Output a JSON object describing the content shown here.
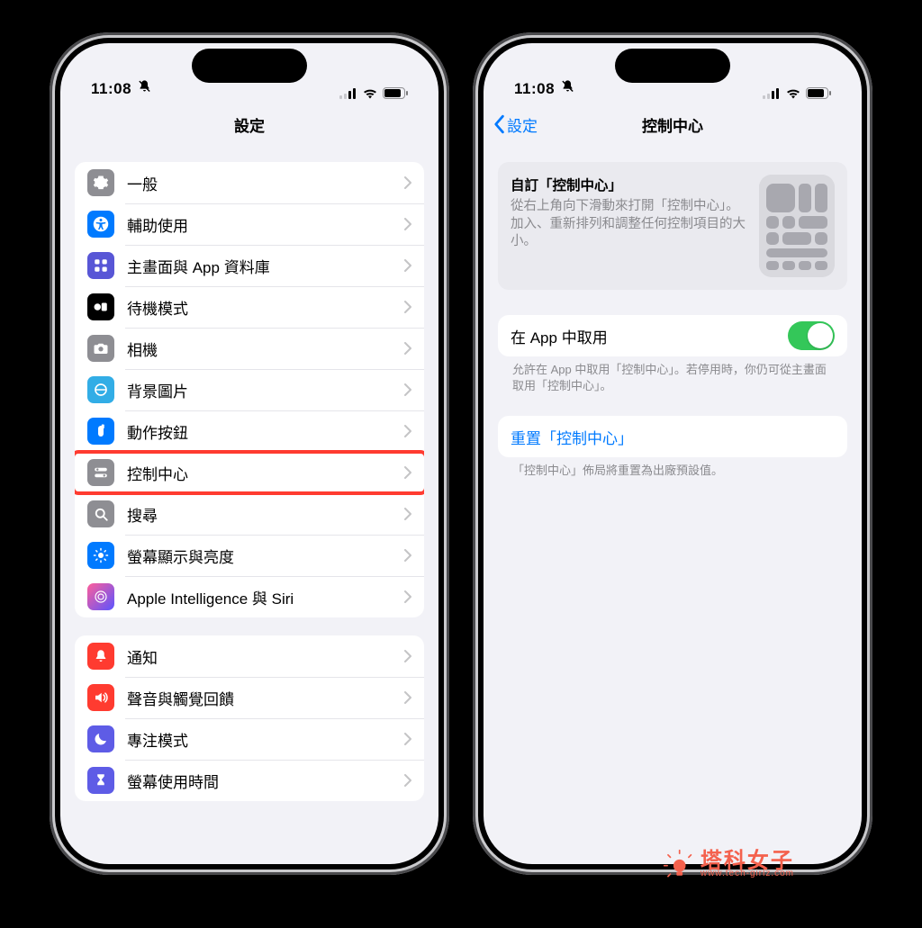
{
  "status": {
    "time": "11:08",
    "silent": true
  },
  "left": {
    "navTitle": "設定",
    "section1": [
      {
        "key": "general",
        "label": "一般",
        "iconBg": "bg-gray",
        "icon": "gear"
      },
      {
        "key": "accessibility",
        "label": "輔助使用",
        "iconBg": "bg-blue",
        "icon": "accessibility"
      },
      {
        "key": "homescreen",
        "label": "主畫面與 App 資料庫",
        "iconBg": "bg-purple",
        "icon": "homegrid"
      },
      {
        "key": "standby",
        "label": "待機模式",
        "iconBg": "bg-black",
        "icon": "standby"
      },
      {
        "key": "camera",
        "label": "相機",
        "iconBg": "bg-gray",
        "icon": "camera"
      },
      {
        "key": "wallpaper",
        "label": "背景圖片",
        "iconBg": "bg-cyan",
        "icon": "wallpaper"
      },
      {
        "key": "actionbutton",
        "label": "動作按鈕",
        "iconBg": "bg-blue",
        "icon": "action"
      },
      {
        "key": "controlcenter",
        "label": "控制中心",
        "iconBg": "bg-gray",
        "icon": "switches",
        "highlight": true
      },
      {
        "key": "search",
        "label": "搜尋",
        "iconBg": "bg-gray",
        "icon": "search"
      },
      {
        "key": "display",
        "label": "螢幕顯示與亮度",
        "iconBg": "bg-blue",
        "icon": "brightness"
      },
      {
        "key": "ai",
        "label": "Apple Intelligence 與 Siri",
        "iconBg": "bg-grad",
        "icon": "ai"
      }
    ],
    "section2": [
      {
        "key": "notifications",
        "label": "通知",
        "iconBg": "bg-red",
        "icon": "bell"
      },
      {
        "key": "sounds",
        "label": "聲音與觸覺回饋",
        "iconBg": "bg-red",
        "icon": "speaker"
      },
      {
        "key": "focus",
        "label": "專注模式",
        "iconBg": "bg-indigo",
        "icon": "moon"
      },
      {
        "key": "screentime",
        "label": "螢幕使用時間",
        "iconBg": "bg-indigo",
        "icon": "hourglass"
      }
    ]
  },
  "right": {
    "backLabel": "設定",
    "navTitle": "控制中心",
    "card": {
      "title": "自訂「控制中心」",
      "desc": "從右上角向下滑動來打開「控制中心」。加入、重新排列和調整任何控制項目的大小。"
    },
    "toggleRow": {
      "label": "在 App 中取用",
      "on": true
    },
    "toggleFooter": "允許在 App 中取用「控制中心」。若停用時，你仍可從主畫面取用「控制中心」。",
    "resetRow": {
      "label": "重置「控制中心」",
      "highlight": true
    },
    "resetFooter": "「控制中心」佈局將重置為出廠預設值。"
  },
  "watermark": {
    "main": "塔科女子",
    "sub": "www.tech-girlz.com"
  }
}
